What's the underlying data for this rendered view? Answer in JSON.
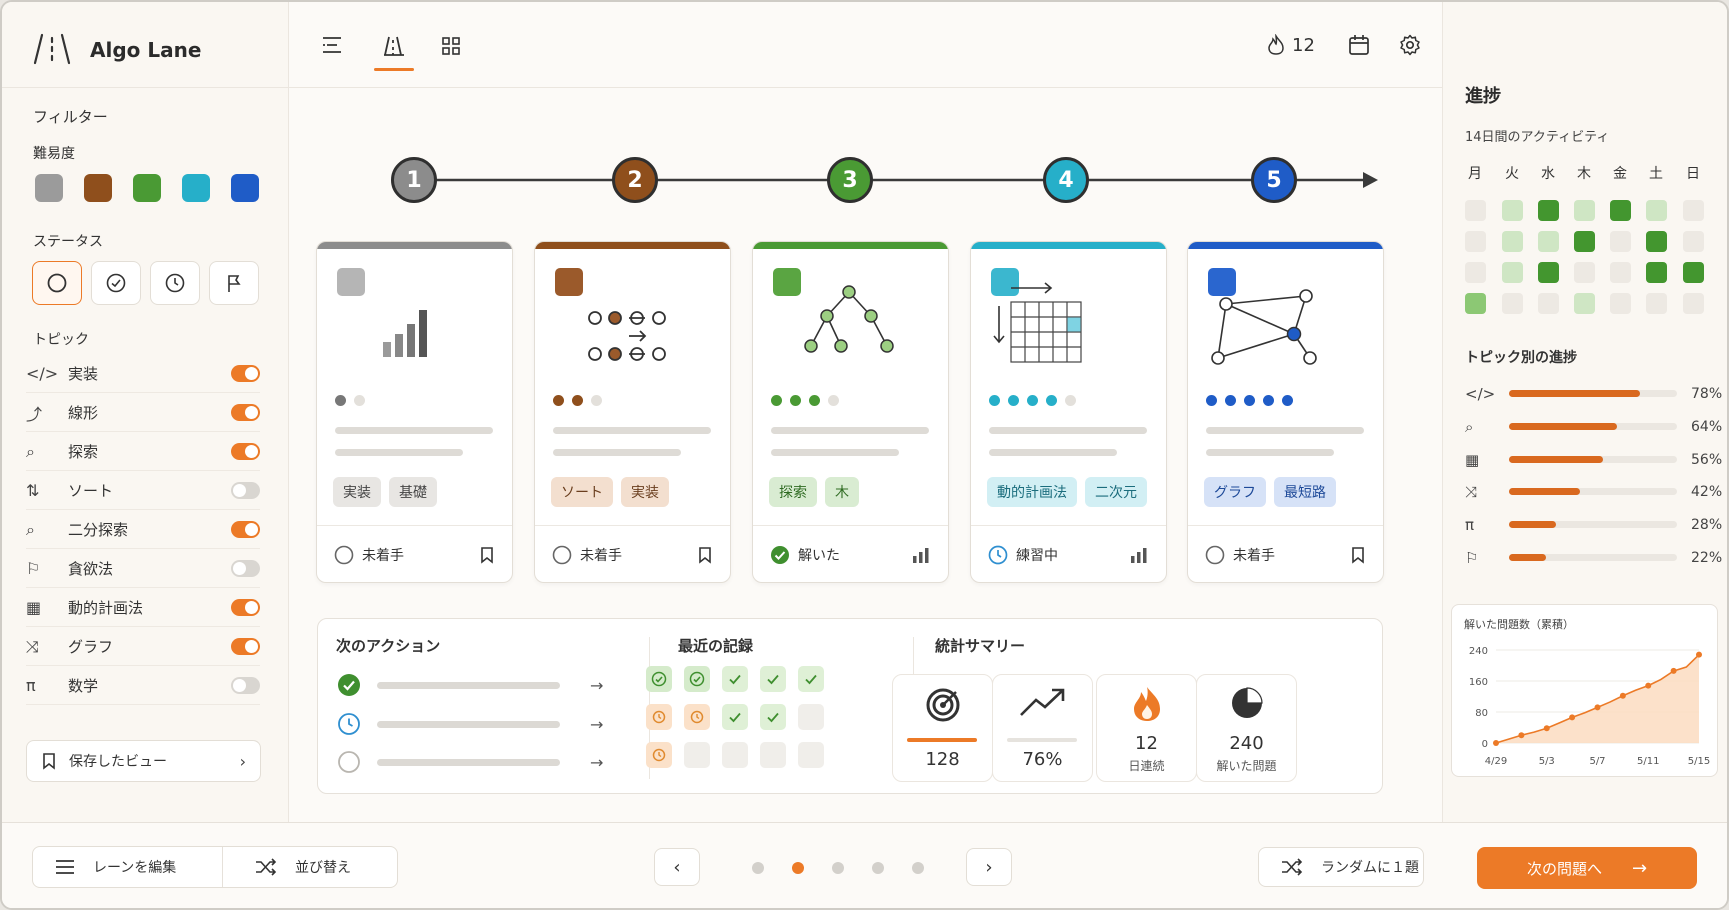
{
  "app": {
    "title": "Algo Lane",
    "logo": "/¦\\"
  },
  "topbar": {
    "views": [
      "list-view-icon",
      "lane-view-icon",
      "grid-view-icon"
    ],
    "streak": "12"
  },
  "filters": {
    "title": "フィルター",
    "difficulty_label": "難易度",
    "difficulty_colors": [
      "#9b9b9b",
      "#8f4f1c",
      "#4a9a34",
      "#26afc9",
      "#1f5cc7"
    ],
    "status_label": "ステータス",
    "topic_label": "トピック",
    "topics": [
      {
        "icon": "</>",
        "label": "実装",
        "on": true
      },
      {
        "icon": "⤴",
        "label": "線形",
        "on": true
      },
      {
        "icon": "⌕",
        "label": "探索",
        "on": true
      },
      {
        "icon": "⇅",
        "label": "ソート",
        "on": false
      },
      {
        "icon": "⌕",
        "label": "二分探索",
        "on": true
      },
      {
        "icon": "⚐",
        "label": "貪欲法",
        "on": false
      },
      {
        "icon": "▦",
        "label": "動的計画法",
        "on": true
      },
      {
        "icon": "⤨",
        "label": "グラフ",
        "on": true
      },
      {
        "icon": "π",
        "label": "数学",
        "on": false
      }
    ],
    "saved_views": "保存したビュー"
  },
  "lane": {
    "steps": [
      "1",
      "2",
      "3",
      "4",
      "5"
    ],
    "step_colors": [
      "#8c8c8c",
      "#8f4f1c",
      "#4a9a34",
      "#26afc9",
      "#1f5cc7"
    ]
  },
  "cards": [
    {
      "color": "#8c8c8c",
      "sq": "#b5b5b5",
      "dots": 1,
      "dotcolor": "#777777",
      "tags": [
        "実装",
        "基礎"
      ],
      "tagbg": "#e8e6e3",
      "tagfg": "#444444",
      "status": "未着手",
      "status_icon": "circle-icon",
      "action": "bookmark-icon"
    },
    {
      "color": "#8f4f1c",
      "sq": "#9b5a2b",
      "dots": 2,
      "dotcolor": "#8f4f1c",
      "tags": [
        "ソート",
        "実装"
      ],
      "tagbg": "#f3dfcf",
      "tagfg": "#6a3e1e",
      "status": "未着手",
      "status_icon": "circle-icon",
      "action": "bookmark-icon"
    },
    {
      "color": "#4a9a34",
      "sq": "#5aa542",
      "dots": 3,
      "dotcolor": "#4a9a34",
      "tags": [
        "探索",
        "木"
      ],
      "tagbg": "#d9ecd2",
      "tagfg": "#2f6b22",
      "status": "解いた",
      "status_icon": "check-circle-icon",
      "action": "bar-chart-icon"
    },
    {
      "color": "#26afc9",
      "sq": "#3bb7cf",
      "dots": 4,
      "dotcolor": "#26afc9",
      "tags": [
        "動的計画法",
        "二次元"
      ],
      "tagbg": "#d2eff4",
      "tagfg": "#1b6d7d",
      "status": "練習中",
      "status_icon": "clock-icon",
      "action": "bar-chart-icon"
    },
    {
      "color": "#1f5cc7",
      "sq": "#2a66cf",
      "dots": 5,
      "dotcolor": "#1f5cc7",
      "tags": [
        "グラフ",
        "最短路"
      ],
      "tagbg": "#d6e2f7",
      "tagfg": "#1e4a99",
      "status": "未着手",
      "status_icon": "circle-icon",
      "action": "bookmark-icon"
    }
  ],
  "next_actions": {
    "title": "次のアクション"
  },
  "recent": {
    "title": "最近の記録"
  },
  "stats": {
    "title": "統計サマリー",
    "items": [
      {
        "icon": "target-icon",
        "value": "128",
        "sub": ""
      },
      {
        "icon": "trend-icon",
        "value": "76%",
        "sub": ""
      },
      {
        "icon": "flame-icon",
        "value": "12",
        "sub": "日連続"
      },
      {
        "icon": "pie-icon",
        "value": "240",
        "sub": "解いた問題"
      }
    ]
  },
  "progress": {
    "title": "進捗",
    "activity_label": "14日間のアクティビティ",
    "weekdays": [
      "月",
      "火",
      "水",
      "木",
      "金",
      "土",
      "日"
    ],
    "heatmap": [
      [
        0,
        1,
        3,
        1,
        3,
        1,
        0
      ],
      [
        0,
        1,
        1,
        3,
        0,
        3,
        0
      ],
      [
        0,
        1,
        3,
        0,
        0,
        3,
        3
      ],
      [
        2,
        0,
        0,
        1,
        0,
        0,
        0
      ]
    ],
    "topic_title": "トピック別の進捗",
    "topics": [
      {
        "icon": "</>",
        "pct": 78,
        "label": "78%"
      },
      {
        "icon": "⌕",
        "pct": 64,
        "label": "64%"
      },
      {
        "icon": "▦",
        "pct": 56,
        "label": "56%"
      },
      {
        "icon": "⤨",
        "pct": 42,
        "label": "42%"
      },
      {
        "icon": "π",
        "pct": 28,
        "label": "28%"
      },
      {
        "icon": "⚐",
        "pct": 22,
        "label": "22%"
      }
    ]
  },
  "chart_data": {
    "type": "area",
    "title": "解いた問題数（累積）",
    "x": [
      "4/29",
      "4/30",
      "5/1",
      "5/2",
      "5/3",
      "5/4",
      "5/5",
      "5/6",
      "5/7",
      "5/8",
      "5/9",
      "5/10",
      "5/11",
      "5/12",
      "5/13",
      "5/14",
      "5/15"
    ],
    "xticks": [
      "4/29",
      "5/3",
      "5/7",
      "5/11",
      "5/15"
    ],
    "series": [
      {
        "values": [
          0,
          10,
          20,
          28,
          38,
          52,
          66,
          78,
          92,
          106,
          122,
          136,
          148,
          164,
          186,
          196,
          228
        ]
      }
    ],
    "yticks": [
      "240",
      "160",
      "80",
      "0"
    ],
    "ylim": [
      0,
      240
    ]
  },
  "bottom": {
    "edit_lane": "レーンを編集",
    "sort": "並び替え",
    "pages": 5,
    "active_page": 1,
    "random": "ランダムに１題",
    "next": "次の問題へ"
  }
}
